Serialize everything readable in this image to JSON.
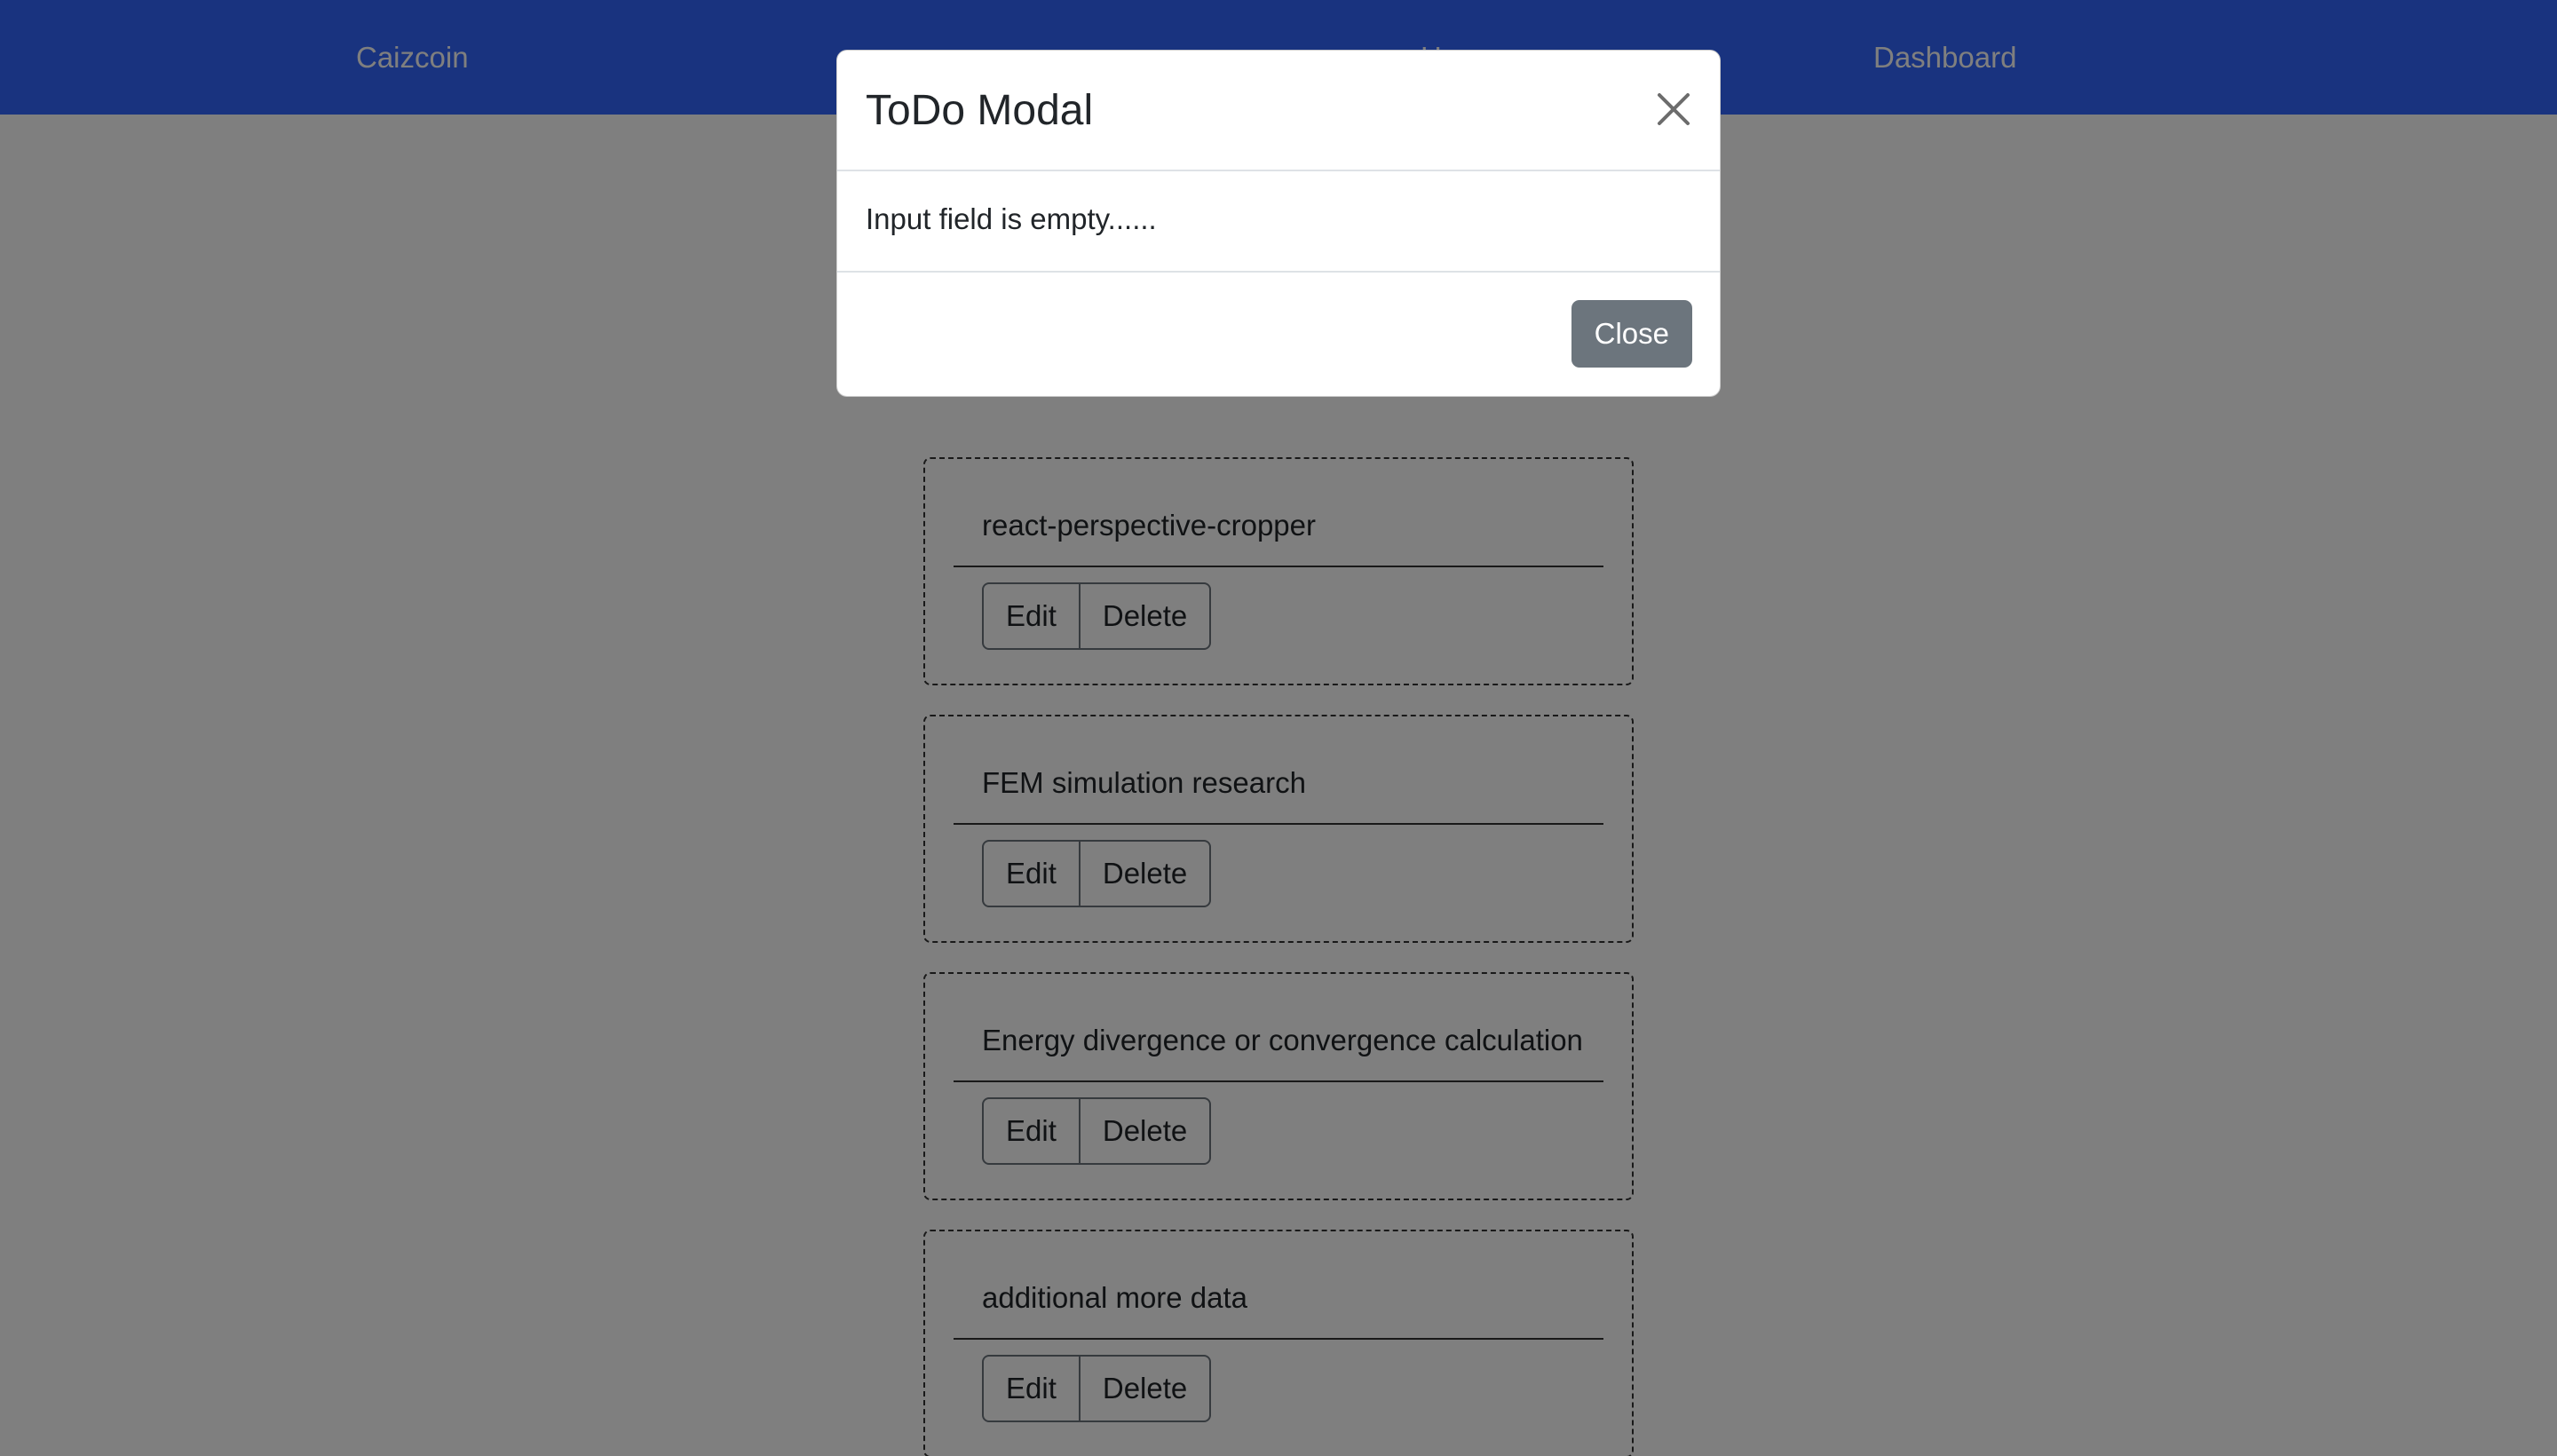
{
  "navbar": {
    "brand": "Caizcoin",
    "home_label": "Home",
    "dashboard_label": "Dashboard",
    "background_color": "#3366ff"
  },
  "todos": [
    {
      "title": "react-perspective-cropper",
      "edit_label": "Edit",
      "delete_label": "Delete"
    },
    {
      "title": "FEM simulation research",
      "edit_label": "Edit",
      "delete_label": "Delete"
    },
    {
      "title": "Energy divergence or convergence calculation",
      "edit_label": "Edit",
      "delete_label": "Delete"
    },
    {
      "title": "additional more data",
      "edit_label": "Edit",
      "delete_label": "Delete"
    }
  ],
  "modal": {
    "title": "ToDo Modal",
    "message": "Input field is empty......",
    "close_button_label": "Close",
    "close_icon": "close-icon",
    "backdrop_color": "rgba(0,0,0,0.5)"
  }
}
